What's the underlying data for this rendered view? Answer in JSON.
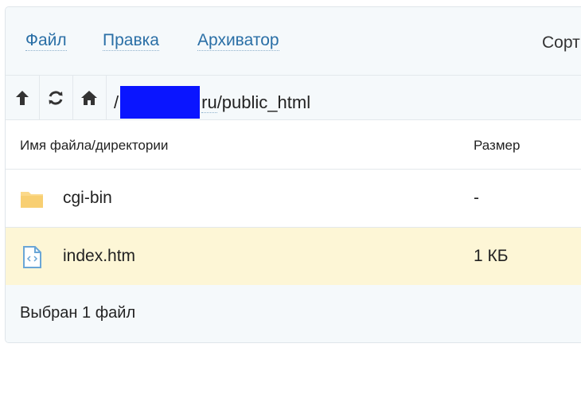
{
  "menu": {
    "items": [
      "Файл",
      "Правка",
      "Архиватор"
    ],
    "sort_label": "Сорт"
  },
  "path": {
    "prefix": "/",
    "suffix": "ru",
    "rest": "/public_html"
  },
  "table": {
    "headers": {
      "name": "Имя файла/директории",
      "size": "Размер"
    },
    "rows": [
      {
        "name": "cgi-bin",
        "size": "-",
        "icon": "folder-icon",
        "selected": false
      },
      {
        "name": "index.htm",
        "size": "1 КБ",
        "icon": "html-file-icon",
        "selected": true
      }
    ]
  },
  "status": {
    "text": "Выбран 1 файл"
  },
  "colors": {
    "accent": "#2a6fa6",
    "selected_row": "#fdf6d6",
    "redaction": "#0a15ff",
    "folder": "#fbd98a"
  }
}
